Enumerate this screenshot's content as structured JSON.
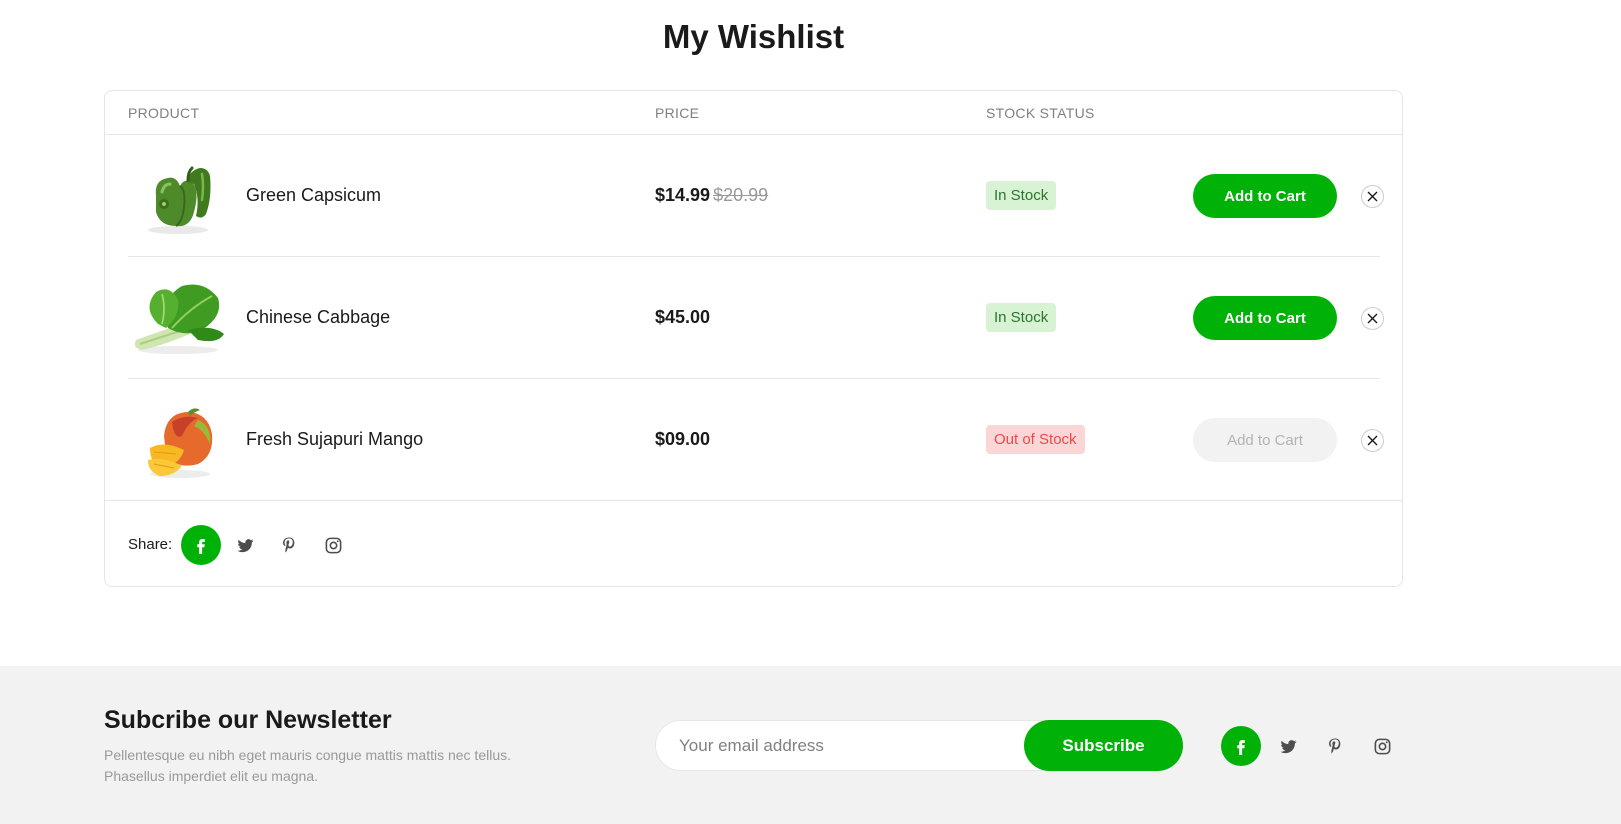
{
  "page": {
    "title": "My Wishlist"
  },
  "table": {
    "headers": {
      "product": "PRODUCT",
      "price": "PRICE",
      "stock": "STOCK STATUS"
    },
    "rows": [
      {
        "name": "Green Capsicum",
        "price": "$14.99",
        "old_price": "$20.99",
        "stock": "In Stock",
        "action": "Add to Cart",
        "image": "green-capsicum-image"
      },
      {
        "name": "Chinese Cabbage",
        "price": "$45.00",
        "old_price": "",
        "stock": "In Stock",
        "action": "Add to Cart",
        "image": "chinese-cabbage-image"
      },
      {
        "name": "Fresh Sujapuri Mango",
        "price": "$09.00",
        "old_price": "",
        "stock": "Out of Stock",
        "action": "Add to Cart",
        "image": "mango-image"
      }
    ]
  },
  "share": {
    "label": "Share:",
    "icons": [
      "facebook-icon",
      "twitter-icon",
      "pinterest-icon",
      "instagram-icon"
    ]
  },
  "newsletter": {
    "title": "Subcribe our Newsletter",
    "text": "Pellentesque eu nibh eget mauris congue mattis mattis nec tellus. Phasellus imperdiet elit eu magna.",
    "placeholder": "Your email address",
    "button": "Subscribe"
  },
  "colors": {
    "brand": "#00b207",
    "in_stock_bg": "#d8f2d4",
    "in_stock_text": "#2c742f",
    "out_stock_bg": "#fbd6d6",
    "out_stock_text": "#ea4b48"
  }
}
